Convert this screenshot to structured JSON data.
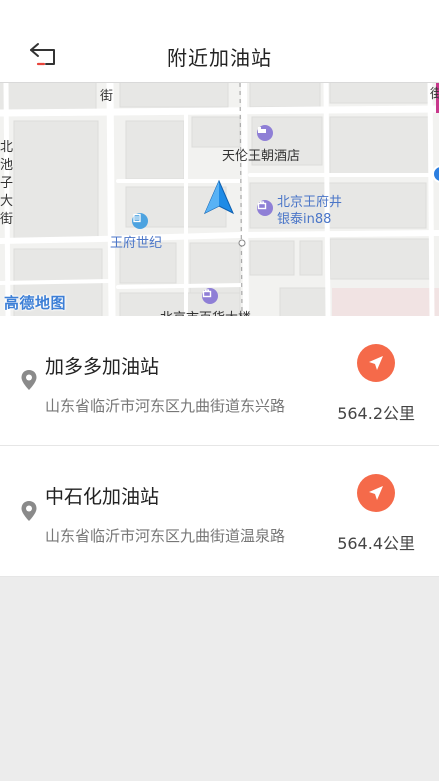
{
  "header": {
    "title": "附近加油站",
    "back_icon": "back-arrow-icon",
    "back_accent": "#e8453c"
  },
  "map": {
    "labels": {
      "street_top": "街",
      "street_right": "街",
      "left_vertical": "北池子大街",
      "hotel": "天伦王朝酒店",
      "wangfujing_1": "北京王府井",
      "wangfujing_2": "银泰in88",
      "wangfu_shiji": "王府世纪",
      "dept_store": "北京市百货大楼",
      "logo": "高德地图"
    },
    "colors": {
      "poi": "#8f7fd6",
      "poi_blue": "#4da3e0",
      "location_arrow": "#1e8be6"
    }
  },
  "stations": [
    {
      "name": "加多多加油站",
      "address": "山东省临沂市河东区九曲街道东兴路",
      "distance": "564.2公里"
    },
    {
      "name": "中石化加油站",
      "address": "山东省临沂市河东区九曲街道温泉路",
      "distance": "564.4公里"
    }
  ],
  "icons": {
    "pin": "location-pin-icon",
    "navigate": "navigate-arrow-icon"
  },
  "colors": {
    "navigate_button": "#f56a4a",
    "page_background": "#ececec"
  }
}
